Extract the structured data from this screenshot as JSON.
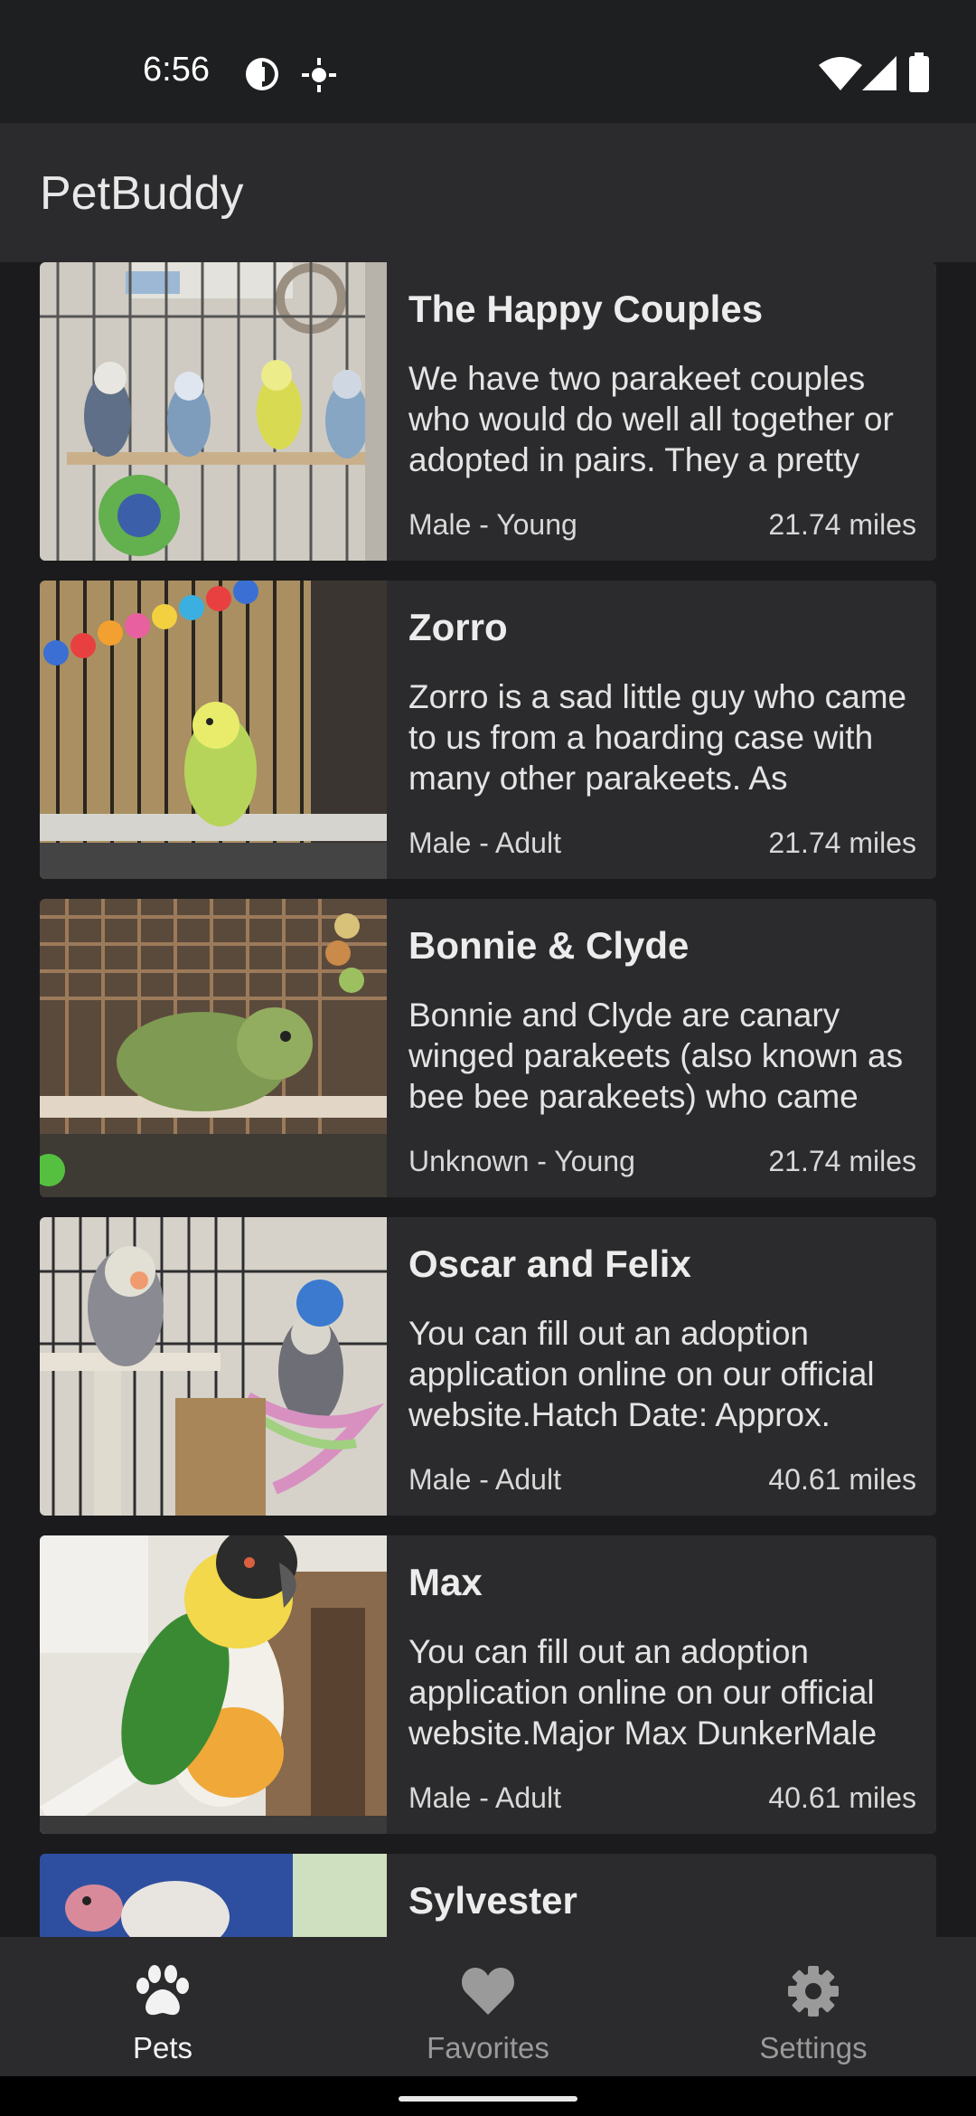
{
  "status_bar": {
    "time": "6:56",
    "icons": [
      "data-saver-icon",
      "location-icon",
      "wifi-icon",
      "signal-icon",
      "battery-icon"
    ]
  },
  "app_bar": {
    "title": "PetBuddy"
  },
  "pets": [
    {
      "name": "The Happy Couples",
      "description": "We have two parakeet couples who would do well all together or adopted in pairs.  They a pretty",
      "meta": "Male - Young",
      "distance": "21.74 miles"
    },
    {
      "name": "Zorro",
      "description": "Zorro is a sad little guy who came to us from a hoarding case with many other parakeets.   As",
      "meta": "Male - Adult",
      "distance": "21.74 miles"
    },
    {
      "name": "Bonnie & Clyde",
      "description": "Bonnie and Clyde are canary winged parakeets (also known as bee bee parakeets) who came",
      "meta": "Unknown - Young",
      "distance": "21.74 miles"
    },
    {
      "name": "Oscar and Felix",
      "description": "You can fill out an adoption application online on our official website.Hatch Date: Approx.",
      "meta": "Male - Adult",
      "distance": "40.61 miles"
    },
    {
      "name": "Max",
      "description": "You can fill out an adoption application online on our official website.Major Max DunkerMale",
      "meta": "Male - Adult",
      "distance": "40.61 miles"
    },
    {
      "name": "Sylvester",
      "description": "",
      "meta": "",
      "distance": ""
    }
  ],
  "bottom_nav": {
    "items": [
      {
        "label": "Pets",
        "icon": "paw-icon",
        "active": true
      },
      {
        "label": "Favorites",
        "icon": "heart-icon",
        "active": false
      },
      {
        "label": "Settings",
        "icon": "gear-icon",
        "active": false
      }
    ]
  },
  "colors": {
    "background": "#1b1b1d",
    "surface": "#2b2b2d",
    "status_bar": "#1e1f21",
    "text_primary": "#ececec",
    "nav_inactive": "#9a9a9a"
  }
}
